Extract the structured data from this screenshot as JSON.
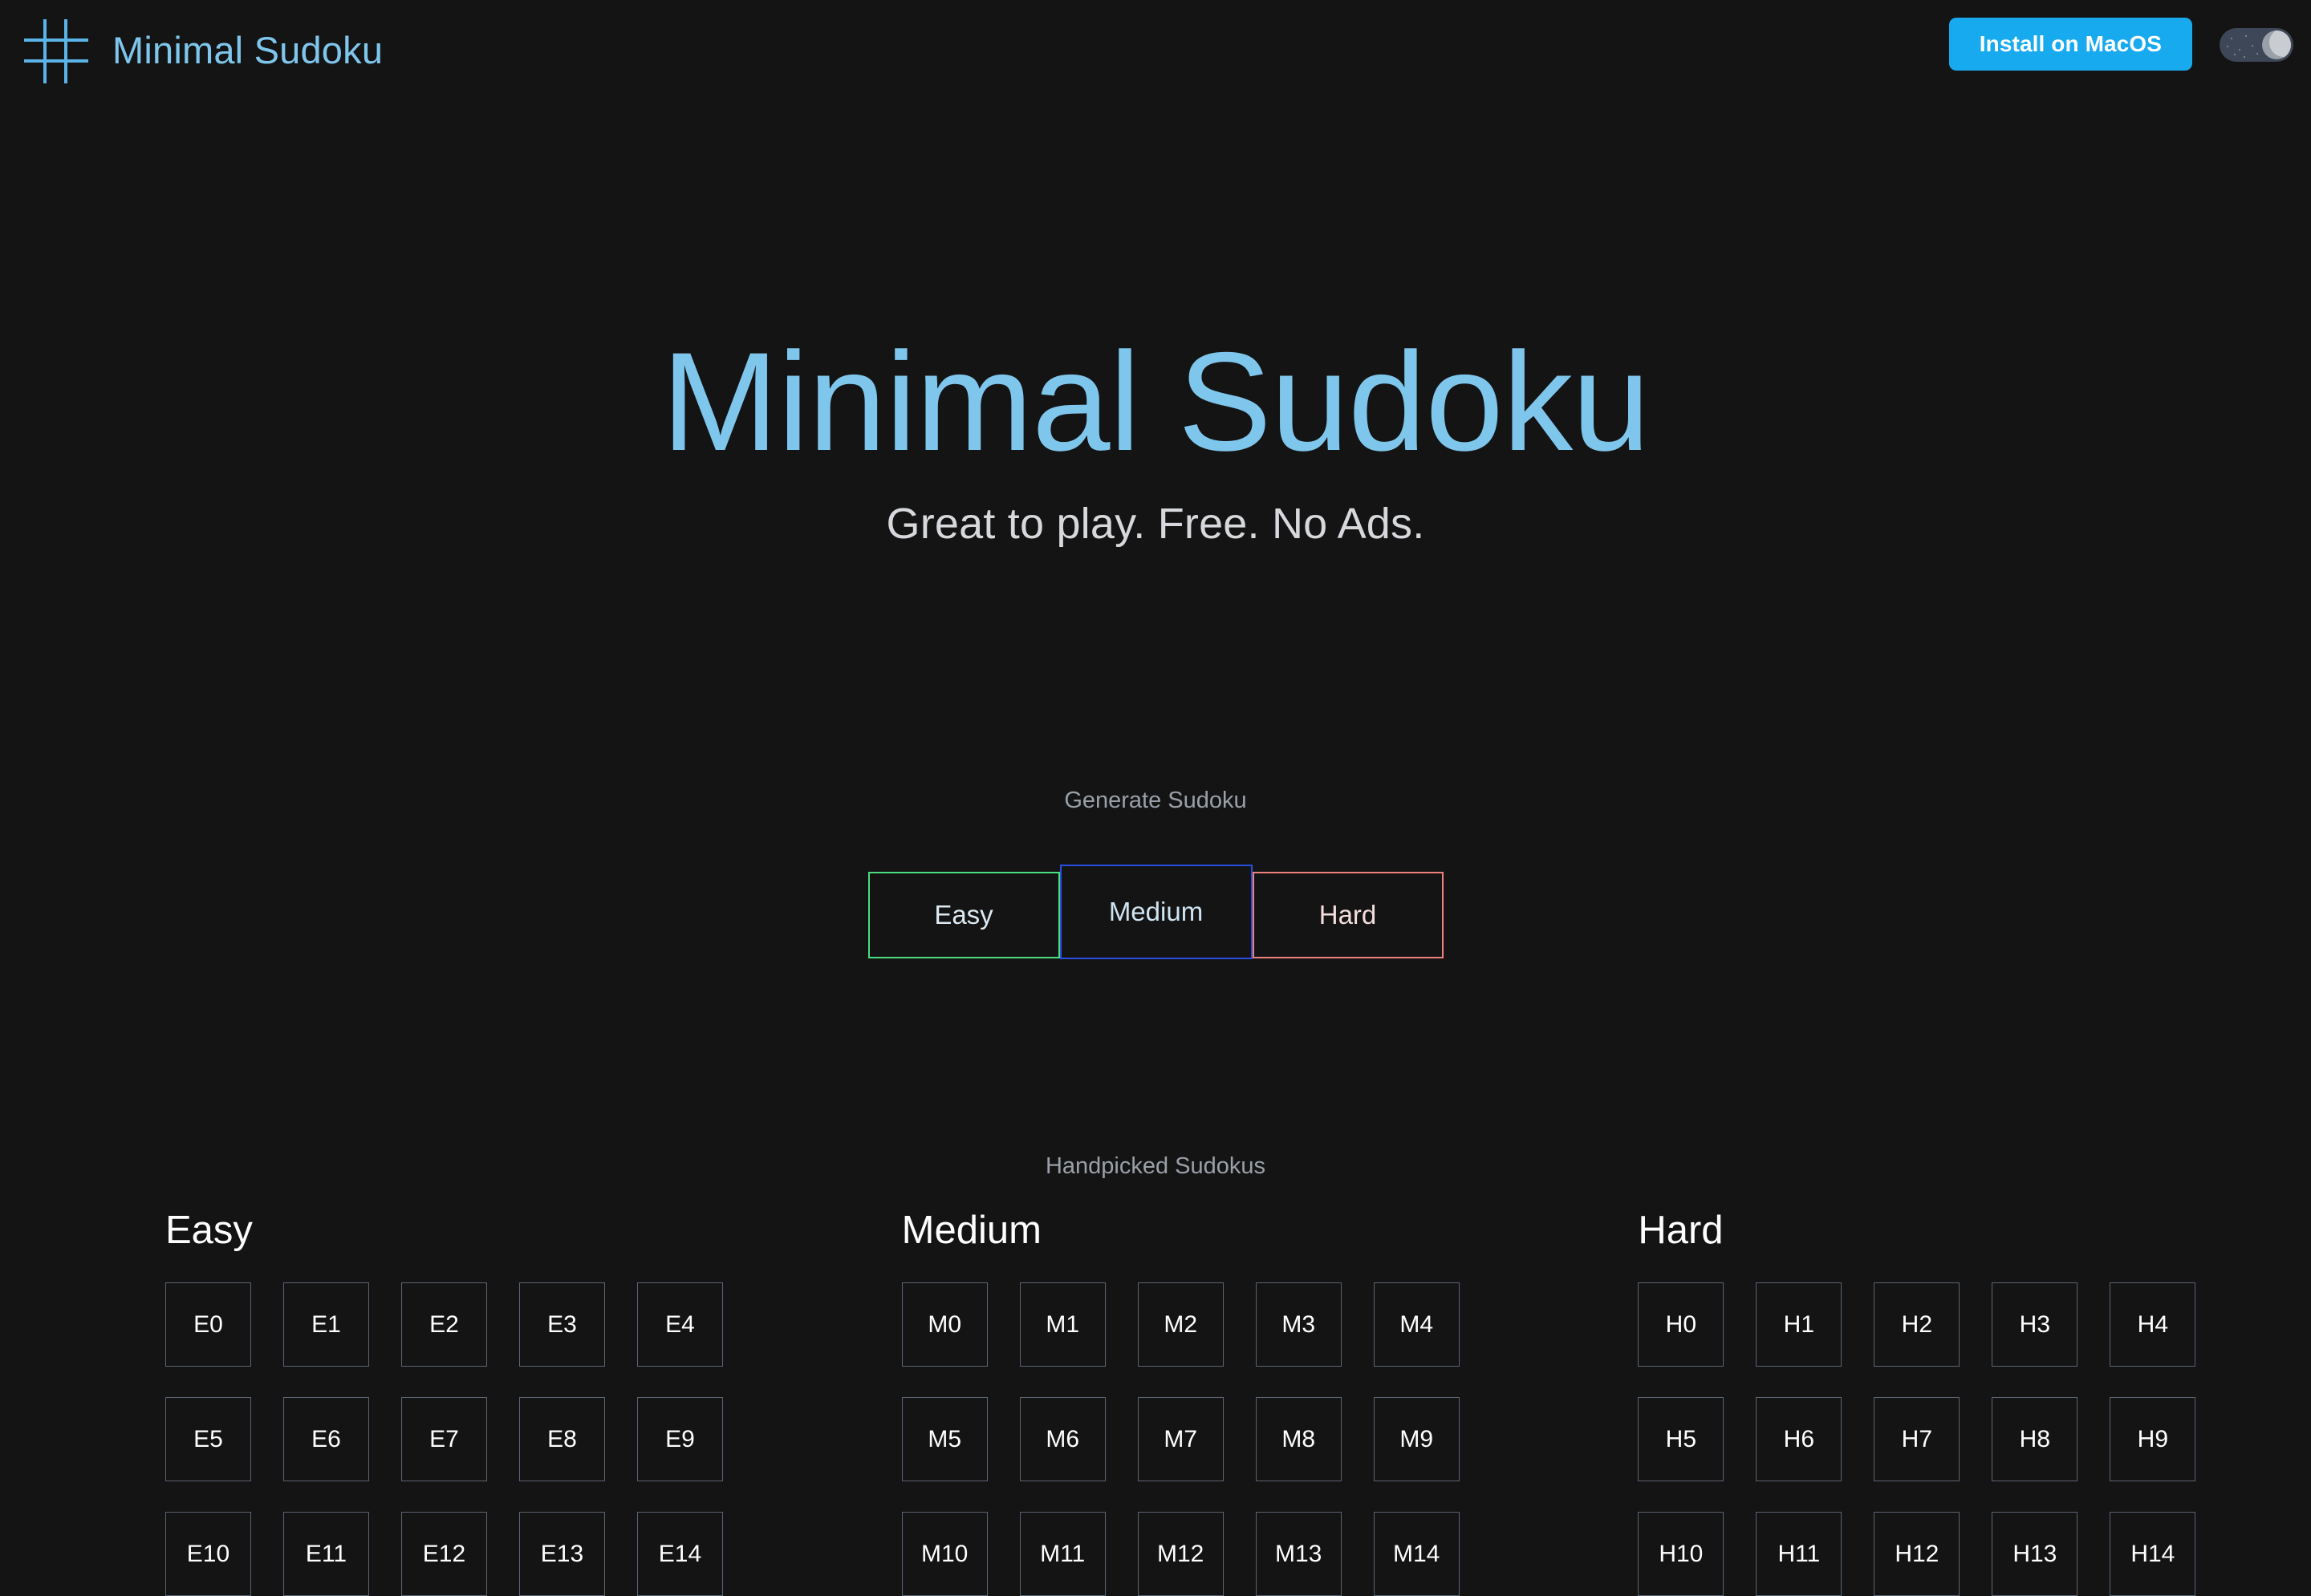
{
  "header": {
    "logo_icon": "sudoku-grid-hash-icon",
    "brand": "Minimal Sudoku",
    "install_label": "Install on MacOS",
    "theme_toggle_icon": "moon-icon",
    "theme_toggle_state": "dark",
    "accent_color": "#18AAEF",
    "brand_color": "#7FC6EC"
  },
  "hero": {
    "title": "Minimal Sudoku",
    "subtitle": "Great to play. Free. No Ads.",
    "title_color": "#7FC6EC",
    "subtitle_color": "#D6D8DB"
  },
  "generate": {
    "label": "Generate Sudoku",
    "buttons": [
      {
        "label": "Easy",
        "border_color": "#4BDE80"
      },
      {
        "label": "Medium",
        "border_color": "#2A4FE0"
      },
      {
        "label": "Hard",
        "border_color": "#F0807E"
      }
    ]
  },
  "handpicked": {
    "label": "Handpicked Sudokus",
    "columns": [
      {
        "title": "Easy",
        "puzzles": [
          "E0",
          "E1",
          "E2",
          "E3",
          "E4",
          "E5",
          "E6",
          "E7",
          "E8",
          "E9",
          "E10",
          "E11",
          "E12",
          "E13",
          "E14"
        ]
      },
      {
        "title": "Medium",
        "puzzles": [
          "M0",
          "M1",
          "M2",
          "M3",
          "M4",
          "M5",
          "M6",
          "M7",
          "M8",
          "M9",
          "M10",
          "M11",
          "M12",
          "M13",
          "M14"
        ]
      },
      {
        "title": "Hard",
        "puzzles": [
          "H0",
          "H1",
          "H2",
          "H3",
          "H4",
          "H5",
          "H6",
          "H7",
          "H8",
          "H9",
          "H10",
          "H11",
          "H12",
          "H13",
          "H14"
        ]
      }
    ]
  },
  "theme": {
    "background": "#141414",
    "puzzle_border": "#5B6471",
    "muted_text": "#9AA0A8"
  }
}
